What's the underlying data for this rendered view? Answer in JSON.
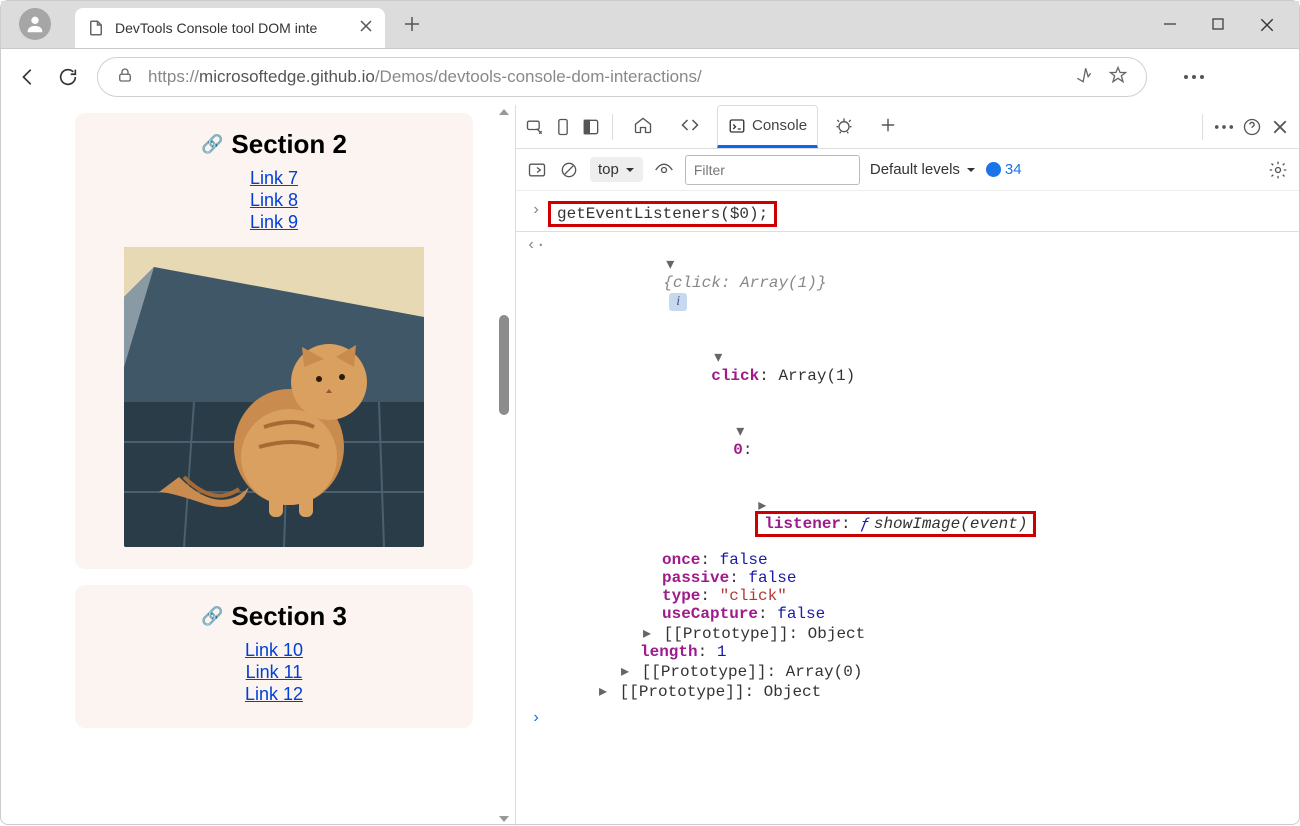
{
  "window": {
    "tab_title": "DevTools Console tool DOM inte",
    "url_prefix": "https://",
    "url_host": "microsoftedge.github.io",
    "url_path": "/Demos/devtools-console-dom-interactions/"
  },
  "page": {
    "section2": {
      "title": "Section 2",
      "links": [
        "Link 7",
        "Link 8",
        "Link 9"
      ]
    },
    "section3": {
      "title": "Section 3",
      "links": [
        "Link 10",
        "Link 11",
        "Link 12"
      ]
    },
    "image_alt": "Orange fluffy cat sitting on blue tiled floor"
  },
  "devtools": {
    "tab_console": "Console",
    "context": "top",
    "filter_placeholder": "Filter",
    "levels_label": "Default levels",
    "issue_count": "34"
  },
  "console": {
    "input": "getEventListeners($0);",
    "summary_key": "click:",
    "summary_val": " Array(1)",
    "click_label": "click",
    "click_val": "Array(1)",
    "idx": "0",
    "listener_key": "listener",
    "listener_val": "showImage(event)",
    "once_key": "once",
    "once_val": "false",
    "passive_key": "passive",
    "passive_val": "false",
    "type_key": "type",
    "type_val": "\"click\"",
    "usecap_key": "useCapture",
    "usecap_val": "false",
    "proto_key": "[[Prototype]]",
    "proto_obj": "Object",
    "length_key": "length",
    "length_val": "1",
    "proto_arr": "Array(0)"
  }
}
